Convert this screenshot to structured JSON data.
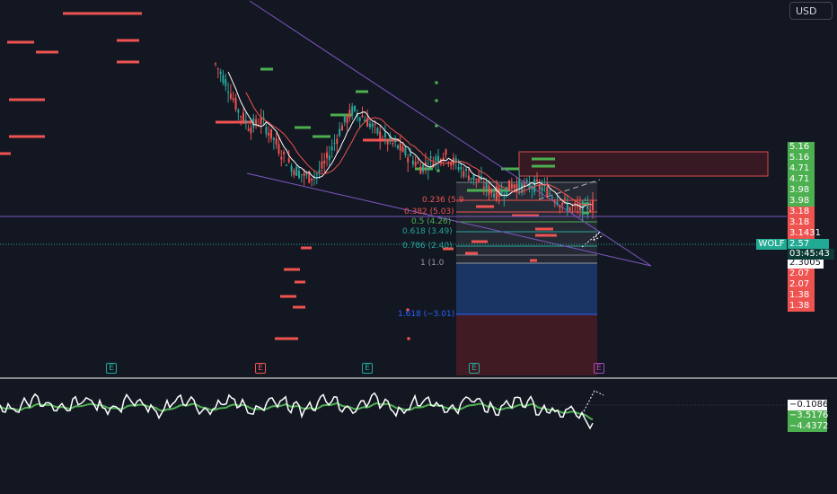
{
  "header": {
    "currency": "USD"
  },
  "symbol": "WOLF",
  "current_price": "2.57",
  "countdown": "03:45:43",
  "price_labels": [
    {
      "text": "5.16",
      "color": "green"
    },
    {
      "text": "5.16",
      "color": "green"
    },
    {
      "text": "4.71",
      "color": "green"
    },
    {
      "text": "4.71",
      "color": "green"
    },
    {
      "text": "3.98",
      "color": "green"
    },
    {
      "text": "3.98",
      "color": "green"
    },
    {
      "text": "3.18",
      "color": "red"
    },
    {
      "text": "3.18",
      "color": "red"
    },
    {
      "text": "3.1431",
      "color": "red"
    },
    {
      "text": "2.3005",
      "color": "white"
    },
    {
      "text": "2.07",
      "color": "red"
    },
    {
      "text": "2.07",
      "color": "red"
    },
    {
      "text": "1.38",
      "color": "red"
    },
    {
      "text": "1.38",
      "color": "red"
    }
  ],
  "fib_levels": [
    {
      "label": "0.236 (5.9",
      "color": "#ef5350"
    },
    {
      "label": "0.382 (5.03)",
      "color": "#ef5350"
    },
    {
      "label": "0.5 (4.26)",
      "color": "#4caf50"
    },
    {
      "label": "0.618 (3.49)",
      "color": "#26a69a"
    },
    {
      "label": "0.786 (2.40)",
      "color": "#26a69a"
    },
    {
      "label": "1 (1.0",
      "color": "#9598a1"
    },
    {
      "label": "1.618 (−3.01)",
      "color": "#2962ff"
    }
  ],
  "earnings_markers": [
    {
      "text": "E",
      "color": "#26a69a"
    },
    {
      "text": "E",
      "color": "#ef5350"
    },
    {
      "text": "E",
      "color": "#26a69a"
    },
    {
      "text": "E",
      "color": "#26a69a"
    },
    {
      "text": "E",
      "color": "#ab47bc"
    }
  ],
  "oscillator_labels": [
    {
      "text": "−0.1086",
      "color": "white"
    },
    {
      "text": "−3.5176",
      "color": "green"
    },
    {
      "text": "−4.4372",
      "color": "green"
    }
  ],
  "colors": {
    "background": "#131722",
    "up": "#26a69a",
    "down": "#ef5350",
    "ma_fast": "#ffffff",
    "ma_slow": "#ef5350",
    "trendline": "#7e57c2",
    "osc_line": "#ffffff",
    "osc_signal": "#4caf50"
  },
  "chart_data": {
    "type": "candlestick",
    "price_series_approx": [
      6.8,
      6.2,
      5.4,
      4.9,
      5.1,
      4.6,
      4.0,
      3.6,
      3.4,
      3.5,
      4.1,
      4.9,
      5.4,
      5.2,
      4.8,
      4.5,
      4.3,
      4.0,
      3.7,
      3.9,
      4.1,
      3.8,
      3.5,
      3.3,
      3.0,
      2.9,
      3.2,
      3.1,
      3.15,
      3.0,
      2.7,
      2.5,
      2.45,
      2.57
    ],
    "horizontal_levels": [
      5.16,
      4.71,
      3.98,
      3.18,
      3.1431,
      2.3005,
      2.07,
      1.38
    ],
    "last_price": 2.57
  }
}
